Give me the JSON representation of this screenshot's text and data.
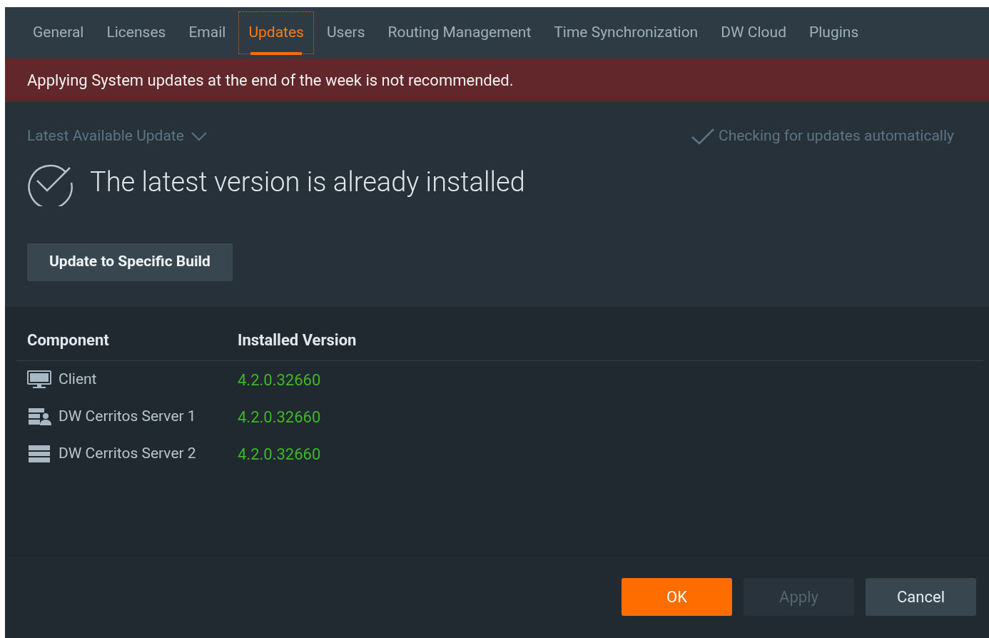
{
  "tabs": [
    {
      "label": "General",
      "selected": false
    },
    {
      "label": "Licenses",
      "selected": false
    },
    {
      "label": "Email",
      "selected": false
    },
    {
      "label": "Updates",
      "selected": true
    },
    {
      "label": "Users",
      "selected": false
    },
    {
      "label": "Routing Management",
      "selected": false
    },
    {
      "label": "Time Synchronization",
      "selected": false
    },
    {
      "label": "DW Cloud",
      "selected": false
    },
    {
      "label": "Plugins",
      "selected": false
    }
  ],
  "warning_banner": "Applying System updates at the end of the week is not recommended.",
  "update_source": {
    "label": "Latest Available Update",
    "expanded": false
  },
  "auto_check": {
    "label": "Checking for updates automatically",
    "checked": true
  },
  "status": "The latest version is already installed",
  "specific_build_button": "Update to Specific Build",
  "table": {
    "columns": [
      "Component",
      "Installed Version"
    ],
    "rows": [
      {
        "kind": "client",
        "name": "Client",
        "version": "4.2.0.32660"
      },
      {
        "kind": "current_server",
        "name": "DW Cerritos Server 1",
        "version": "4.2.0.32660"
      },
      {
        "kind": "server",
        "name": "DW Cerritos Server 2",
        "version": "4.2.0.32660"
      }
    ]
  },
  "buttons": [
    {
      "kind": "primary",
      "label": "OK",
      "disabled": false
    },
    {
      "kind": "secondary",
      "label": "Apply",
      "disabled": true
    },
    {
      "kind": "secondary",
      "label": "Cancel",
      "disabled": false
    }
  ]
}
